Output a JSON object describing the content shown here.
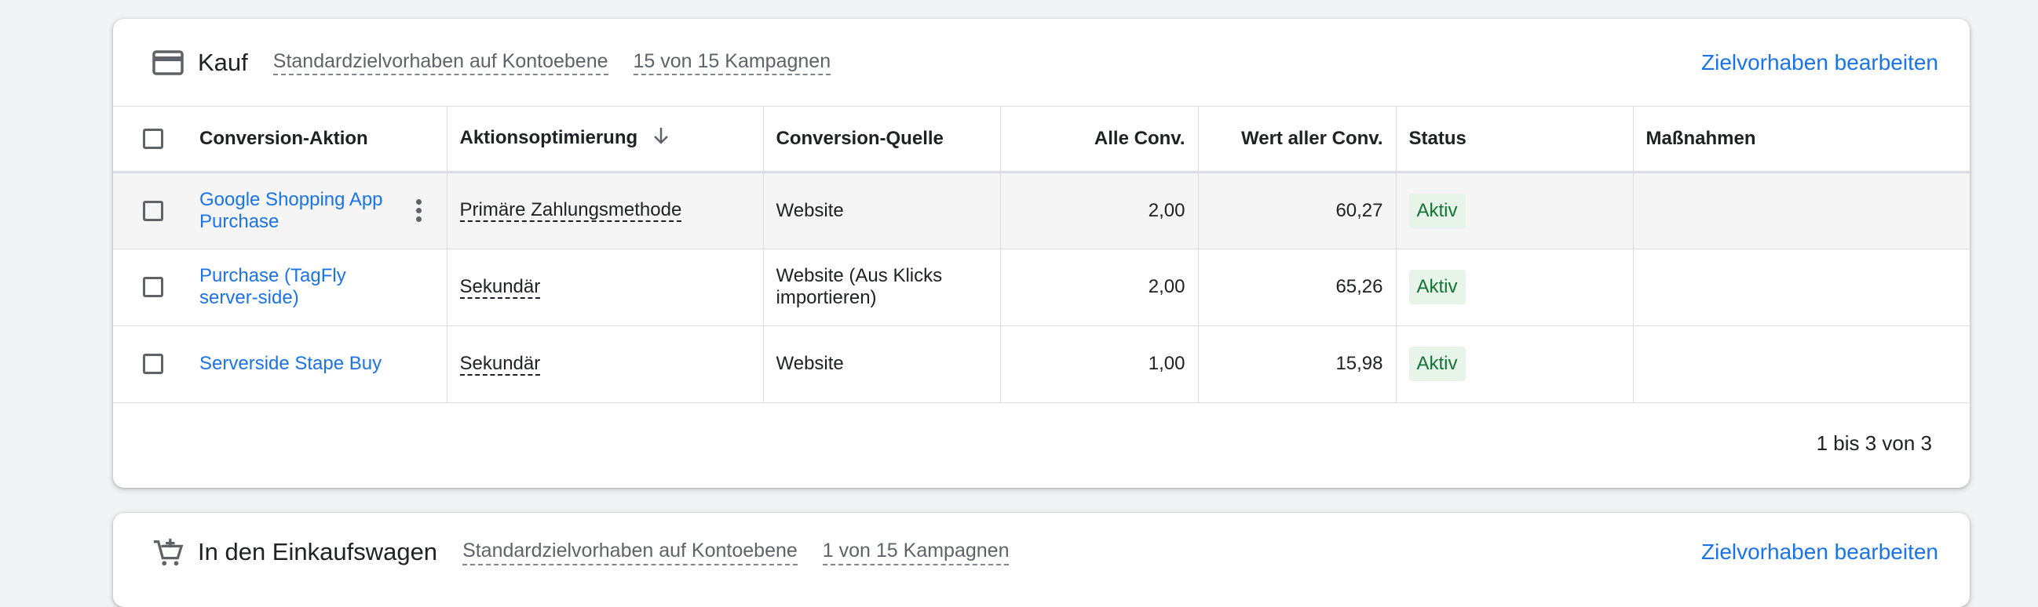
{
  "cards": [
    {
      "title": "Kauf",
      "goal_scope": "Standardzielvorhaben auf Kontoebene",
      "campaigns": "15 von 15 Kampagnen",
      "edit_action": "Zielvorhaben bearbeiten",
      "icon": "credit-card-icon",
      "columns": [
        "Conversion-Aktion",
        "Aktionsoptimierung",
        "Conversion-Quelle",
        "Alle Conv.",
        "Wert aller Conv.",
        "Status",
        "Maßnahmen"
      ],
      "rows": [
        {
          "name": "Google Shopping App Purchase",
          "optimization": "Primäre Zahlungsmethode",
          "source": "Website",
          "all_conv": "2,00",
          "value": "60,27",
          "status": "Aktiv"
        },
        {
          "name": "Purchase (TagFly server-side)",
          "optimization": "Sekundär",
          "source": "Website (Aus Klicks importieren)",
          "all_conv": "2,00",
          "value": "65,26",
          "status": "Aktiv"
        },
        {
          "name": "Serverside Stape Buy",
          "optimization": "Sekundär",
          "source": "Website",
          "all_conv": "1,00",
          "value": "15,98",
          "status": "Aktiv"
        }
      ],
      "pagination": "1 bis 3 von 3"
    },
    {
      "title": "In den Einkaufswagen",
      "goal_scope": "Standardzielvorhaben auf Kontoebene",
      "campaigns": "1 von 15 Kampagnen",
      "edit_action": "Zielvorhaben bearbeiten",
      "icon": "add-to-cart-icon"
    }
  ],
  "colors": {
    "link": "#1a73e8",
    "status_bg": "#e6f4ea",
    "status_text": "#137333",
    "page_bg": "#f1f3f4"
  }
}
